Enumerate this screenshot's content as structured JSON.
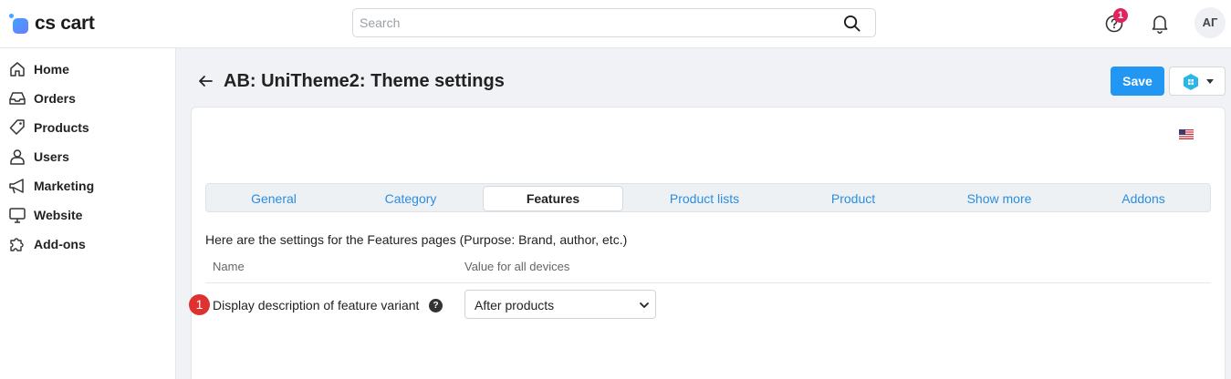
{
  "header": {
    "logo_text": "cs cart",
    "search_placeholder": "Search",
    "notification_count": "1",
    "avatar_initials": "АГ"
  },
  "sidebar": {
    "items": [
      {
        "label": "Home",
        "icon": "home-icon"
      },
      {
        "label": "Orders",
        "icon": "inbox-icon"
      },
      {
        "label": "Products",
        "icon": "tag-icon"
      },
      {
        "label": "Users",
        "icon": "user-icon"
      },
      {
        "label": "Marketing",
        "icon": "megaphone-icon"
      },
      {
        "label": "Website",
        "icon": "monitor-icon"
      },
      {
        "label": "Add-ons",
        "icon": "puzzle-icon"
      }
    ]
  },
  "page": {
    "title": "AB: UniTheme2: Theme settings",
    "save_label": "Save",
    "language_flag": "us-flag-icon"
  },
  "tabs": [
    {
      "label": "General",
      "active": false
    },
    {
      "label": "Category",
      "active": false
    },
    {
      "label": "Features",
      "active": true
    },
    {
      "label": "Product lists",
      "active": false
    },
    {
      "label": "Product",
      "active": false
    },
    {
      "label": "Show more",
      "active": false
    },
    {
      "label": "Addons",
      "active": false
    }
  ],
  "content": {
    "description": "Here are the settings for the Features pages (Purpose: Brand, author, etc.)",
    "columns": {
      "name": "Name",
      "value": "Value for all devices"
    },
    "settings": [
      {
        "step": "1",
        "label": "Display description of feature variant",
        "value": "After products"
      }
    ]
  },
  "colors": {
    "accent": "#2196f3",
    "tab_link": "#2b8de0",
    "badge": "#e0245e",
    "step_badge": "#e03131"
  }
}
